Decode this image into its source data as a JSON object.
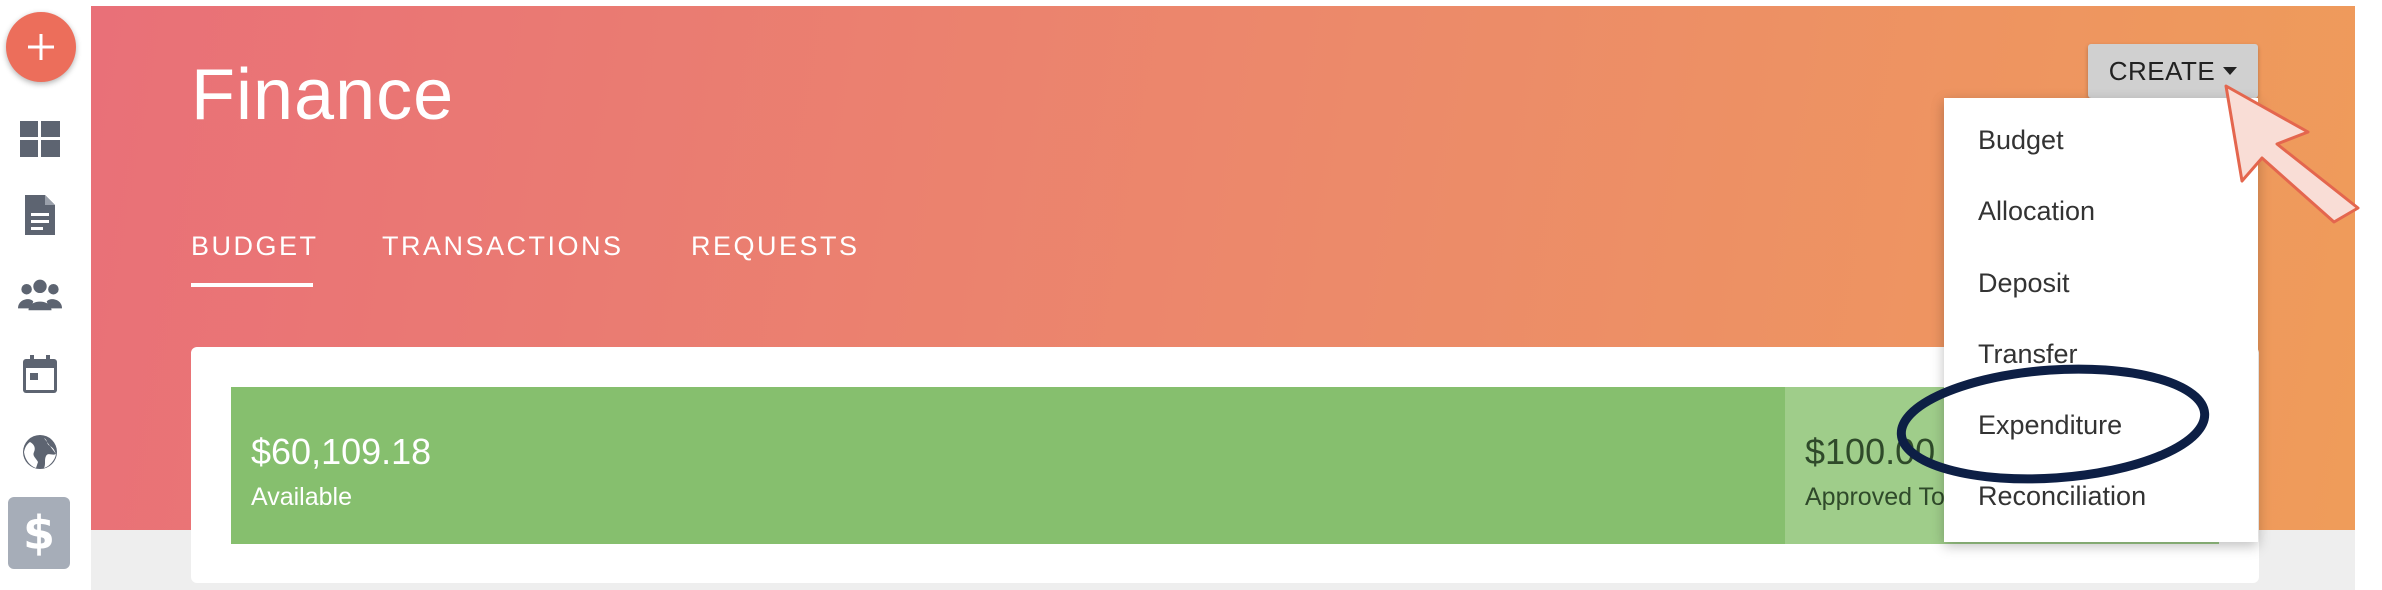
{
  "sidebar": {
    "add_icon": "plus-icon",
    "items": [
      {
        "icon": "dashboard-icon"
      },
      {
        "icon": "document-icon"
      },
      {
        "icon": "people-icon"
      },
      {
        "icon": "calendar-icon"
      },
      {
        "icon": "globe-icon"
      },
      {
        "icon": "dollar-icon",
        "glyph": "$",
        "active": true
      }
    ]
  },
  "header": {
    "title": "Finance",
    "tabs": [
      {
        "label": "BUDGET",
        "active": true
      },
      {
        "label": "TRANSACTIONS"
      },
      {
        "label": "REQUESTS"
      }
    ]
  },
  "budget": {
    "available": {
      "amount": "$60,109.18",
      "label": "Available",
      "color": "#86bf6e"
    },
    "approved": {
      "amount": "$100.00",
      "label": "Approved To",
      "color": "#9fcd8a"
    }
  },
  "create": {
    "label": "CREATE",
    "menu": [
      "Budget",
      "Allocation",
      "Deposit",
      "Transfer",
      "Expenditure",
      "Reconciliation"
    ],
    "highlighted": "Expenditure"
  },
  "colors": {
    "gradient_start": "#e97078",
    "gradient_end": "#ef9c5a",
    "fab": "#ec6e5b",
    "highlight_ring": "#0d1f45",
    "pointer_fill": "#f9ddd6"
  }
}
